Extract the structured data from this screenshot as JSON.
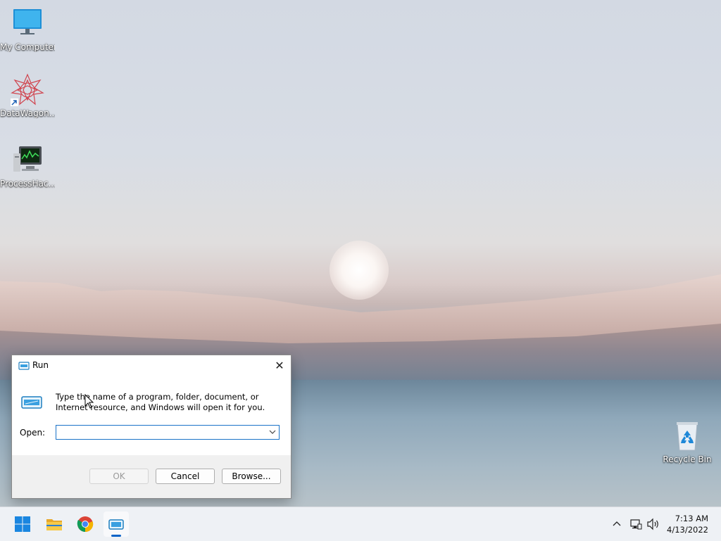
{
  "desktop": {
    "icons": [
      {
        "label": "My Computer"
      },
      {
        "label": "DataWagon..."
      },
      {
        "label": "ProcessHac..."
      },
      {
        "label": "Recycle Bin"
      }
    ]
  },
  "run_dialog": {
    "title": "Run",
    "close_glyph": "✕",
    "description": "Type the name of a program, folder, document, or Internet resource, and Windows will open it for you.",
    "open_label": "Open:",
    "open_value": "",
    "ok_label": "OK",
    "cancel_label": "Cancel",
    "browse_label": "Browse..."
  },
  "taskbar": {
    "items": [
      {
        "name": "start",
        "icon": "windows-logo-icon"
      },
      {
        "name": "file-explorer",
        "icon": "folder-icon"
      },
      {
        "name": "chrome",
        "icon": "chrome-icon"
      },
      {
        "name": "run",
        "icon": "run-icon",
        "active": true
      }
    ],
    "tray": {
      "icons": [
        "chevron-up-icon",
        "network-icon",
        "speaker-icon"
      ]
    },
    "clock": {
      "time": "7:13 AM",
      "date": "4/13/2022"
    }
  },
  "colors": {
    "accent": "#0a64c8",
    "taskbar_bg": "#eef1f5",
    "dialog_footer": "#f0f0f0"
  }
}
